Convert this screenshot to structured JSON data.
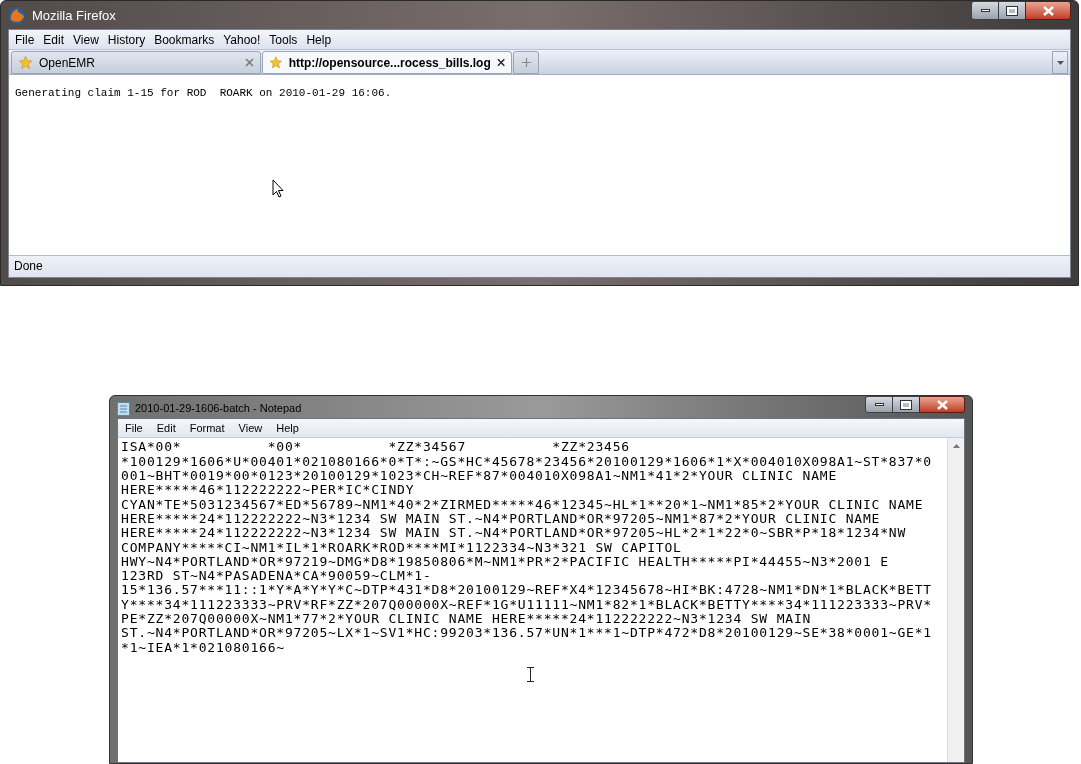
{
  "browser": {
    "title": "Mozilla Firefox",
    "menu": [
      "File",
      "Edit",
      "View",
      "History",
      "Bookmarks",
      "Yahoo!",
      "Tools",
      "Help"
    ],
    "tabs": [
      {
        "label": "OpenEMR",
        "selected": false
      },
      {
        "label": "http://opensource...rocess_bills.log",
        "selected": true
      }
    ],
    "content": "Generating claim 1-15 for ROD  ROARK on 2010-01-29 16:06.",
    "status": "Done"
  },
  "notepad": {
    "title": "2010-01-29-1606-batch - Notepad",
    "menu": [
      "File",
      "Edit",
      "Format",
      "View",
      "Help"
    ],
    "lines": [
      "ISA*00*          *00*          *ZZ*34567          *ZZ*23456",
      "*100129*1606*U*00401*021080166*0*T*:~GS*HC*45678*23456*20100129*1606*1*X*004010X098A1~ST*837*0",
      "001~BHT*0019*00*0123*20100129*1023*CH~REF*87*004010X098A1~NM1*41*2*YOUR CLINIC NAME",
      "HERE*****46*112222222~PER*IC*CINDY",
      "CYAN*TE*5031234567*ED*56789~NM1*40*2*ZIRMED*****46*12345~HL*1**20*1~NM1*85*2*YOUR CLINIC NAME",
      "HERE*****24*112222222~N3*1234 SW MAIN ST.~N4*PORTLAND*OR*97205~NM1*87*2*YOUR CLINIC NAME",
      "HERE*****24*112222222~N3*1234 SW MAIN ST.~N4*PORTLAND*OR*97205~HL*2*1*22*0~SBR*P*18*1234*NW",
      "COMPANY*****CI~NM1*IL*1*ROARK*ROD****MI*1122334~N3*321 SW CAPITOL",
      "HWY~N4*PORTLAND*OR*97219~DMG*D8*19850806*M~NM1*PR*2*PACIFIC HEALTH*****PI*44455~N3*2001 E",
      "123RD ST~N4*PASADENA*CA*90059~CLM*1-",
      "15*136.57***11::1*Y*A*Y*Y*C~DTP*431*D8*20100129~REF*X4*12345678~HI*BK:4728~NM1*DN*1*BLACK*BETT",
      "Y****34*111223333~PRV*RF*ZZ*207Q00000X~REF*1G*U11111~NM1*82*1*BLACK*BETTY****34*111223333~PRV*",
      "PE*ZZ*207Q00000X~NM1*77*2*YOUR CLINIC NAME HERE*****24*112222222~N3*1234 SW MAIN",
      "ST.~N4*PORTLAND*OR*97205~LX*1~SV1*HC:99203*136.57*UN*1***1~DTP*472*D8*20100129~SE*38*0001~GE*1",
      "*1~IEA*1*021080166~"
    ]
  }
}
